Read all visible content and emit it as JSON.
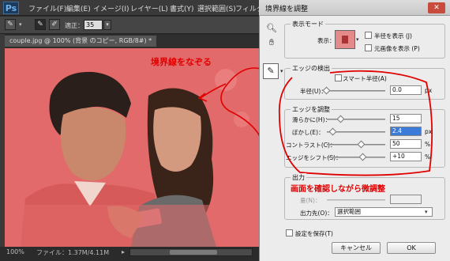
{
  "app": {
    "logo": "Ps"
  },
  "menu": [
    "ファイル(F)",
    "編集(E)",
    "イメージ(I)",
    "レイヤー(L)",
    "書式(Y)",
    "選択範囲(S)",
    "フィルター"
  ],
  "options": {
    "opacity_label": "適正：",
    "opacity_value": "35"
  },
  "document": {
    "tab": "couple.jpg @ 100% (背景 のコピー, RGB/8#) *"
  },
  "status": {
    "zoom": "100%",
    "file": "ファイル：1.37M/4.11M"
  },
  "dialog": {
    "title": "境界線を調整",
    "view_mode": {
      "label": "表示モード",
      "display_label": "表示：",
      "show_radius": "半径を表示 (J)",
      "show_original": "元画像を表示 (P)"
    },
    "edge_detect": {
      "label": "エッジの検出",
      "smart_radius": "スマート半径(A)",
      "radius_label": "半径(U)：",
      "radius_value": "0.0",
      "radius_unit": "px"
    },
    "adjust_edge": {
      "label": "エッジを調整",
      "smooth_label": "滑らかに(H)：",
      "smooth_value": "15",
      "feather_label": "ぼかし(E)：",
      "feather_value": "2.4",
      "feather_unit": "px",
      "contrast_label": "コントラスト(C)：",
      "contrast_value": "50",
      "contrast_unit": "%",
      "shift_label": "エッジをシフト(S)：",
      "shift_value": "+10",
      "shift_unit": "%"
    },
    "output": {
      "label": "出力",
      "amount_label": "量(N)：",
      "output_to_label": "出力先(O)：",
      "output_to_value": "選択範囲"
    },
    "remember_label": "設定を保存(T)",
    "cancel": "キャンセル",
    "ok": "OK"
  },
  "annotations": {
    "trace": "境界線をなぞる",
    "adjust": "画面を確認しながら微調整"
  },
  "colors": {
    "annotation_red": "#e00000",
    "mask_overlay": "#e07070"
  }
}
